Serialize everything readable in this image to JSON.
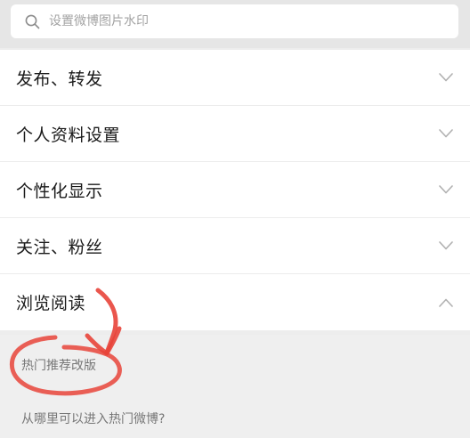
{
  "search": {
    "placeholder": "设置微博图片水印"
  },
  "sections": [
    {
      "label": "发布、转发",
      "expanded": false
    },
    {
      "label": "个人资料设置",
      "expanded": false
    },
    {
      "label": "个性化显示",
      "expanded": false
    },
    {
      "label": "关注、粉丝",
      "expanded": false
    },
    {
      "label": "浏览阅读",
      "expanded": true
    }
  ],
  "browse_items": [
    {
      "label": "热门推荐改版"
    },
    {
      "label": "从哪里可以进入热门微博?"
    }
  ],
  "colors": {
    "annotation": "#e8443a",
    "chevron": "#b0b0b0"
  }
}
